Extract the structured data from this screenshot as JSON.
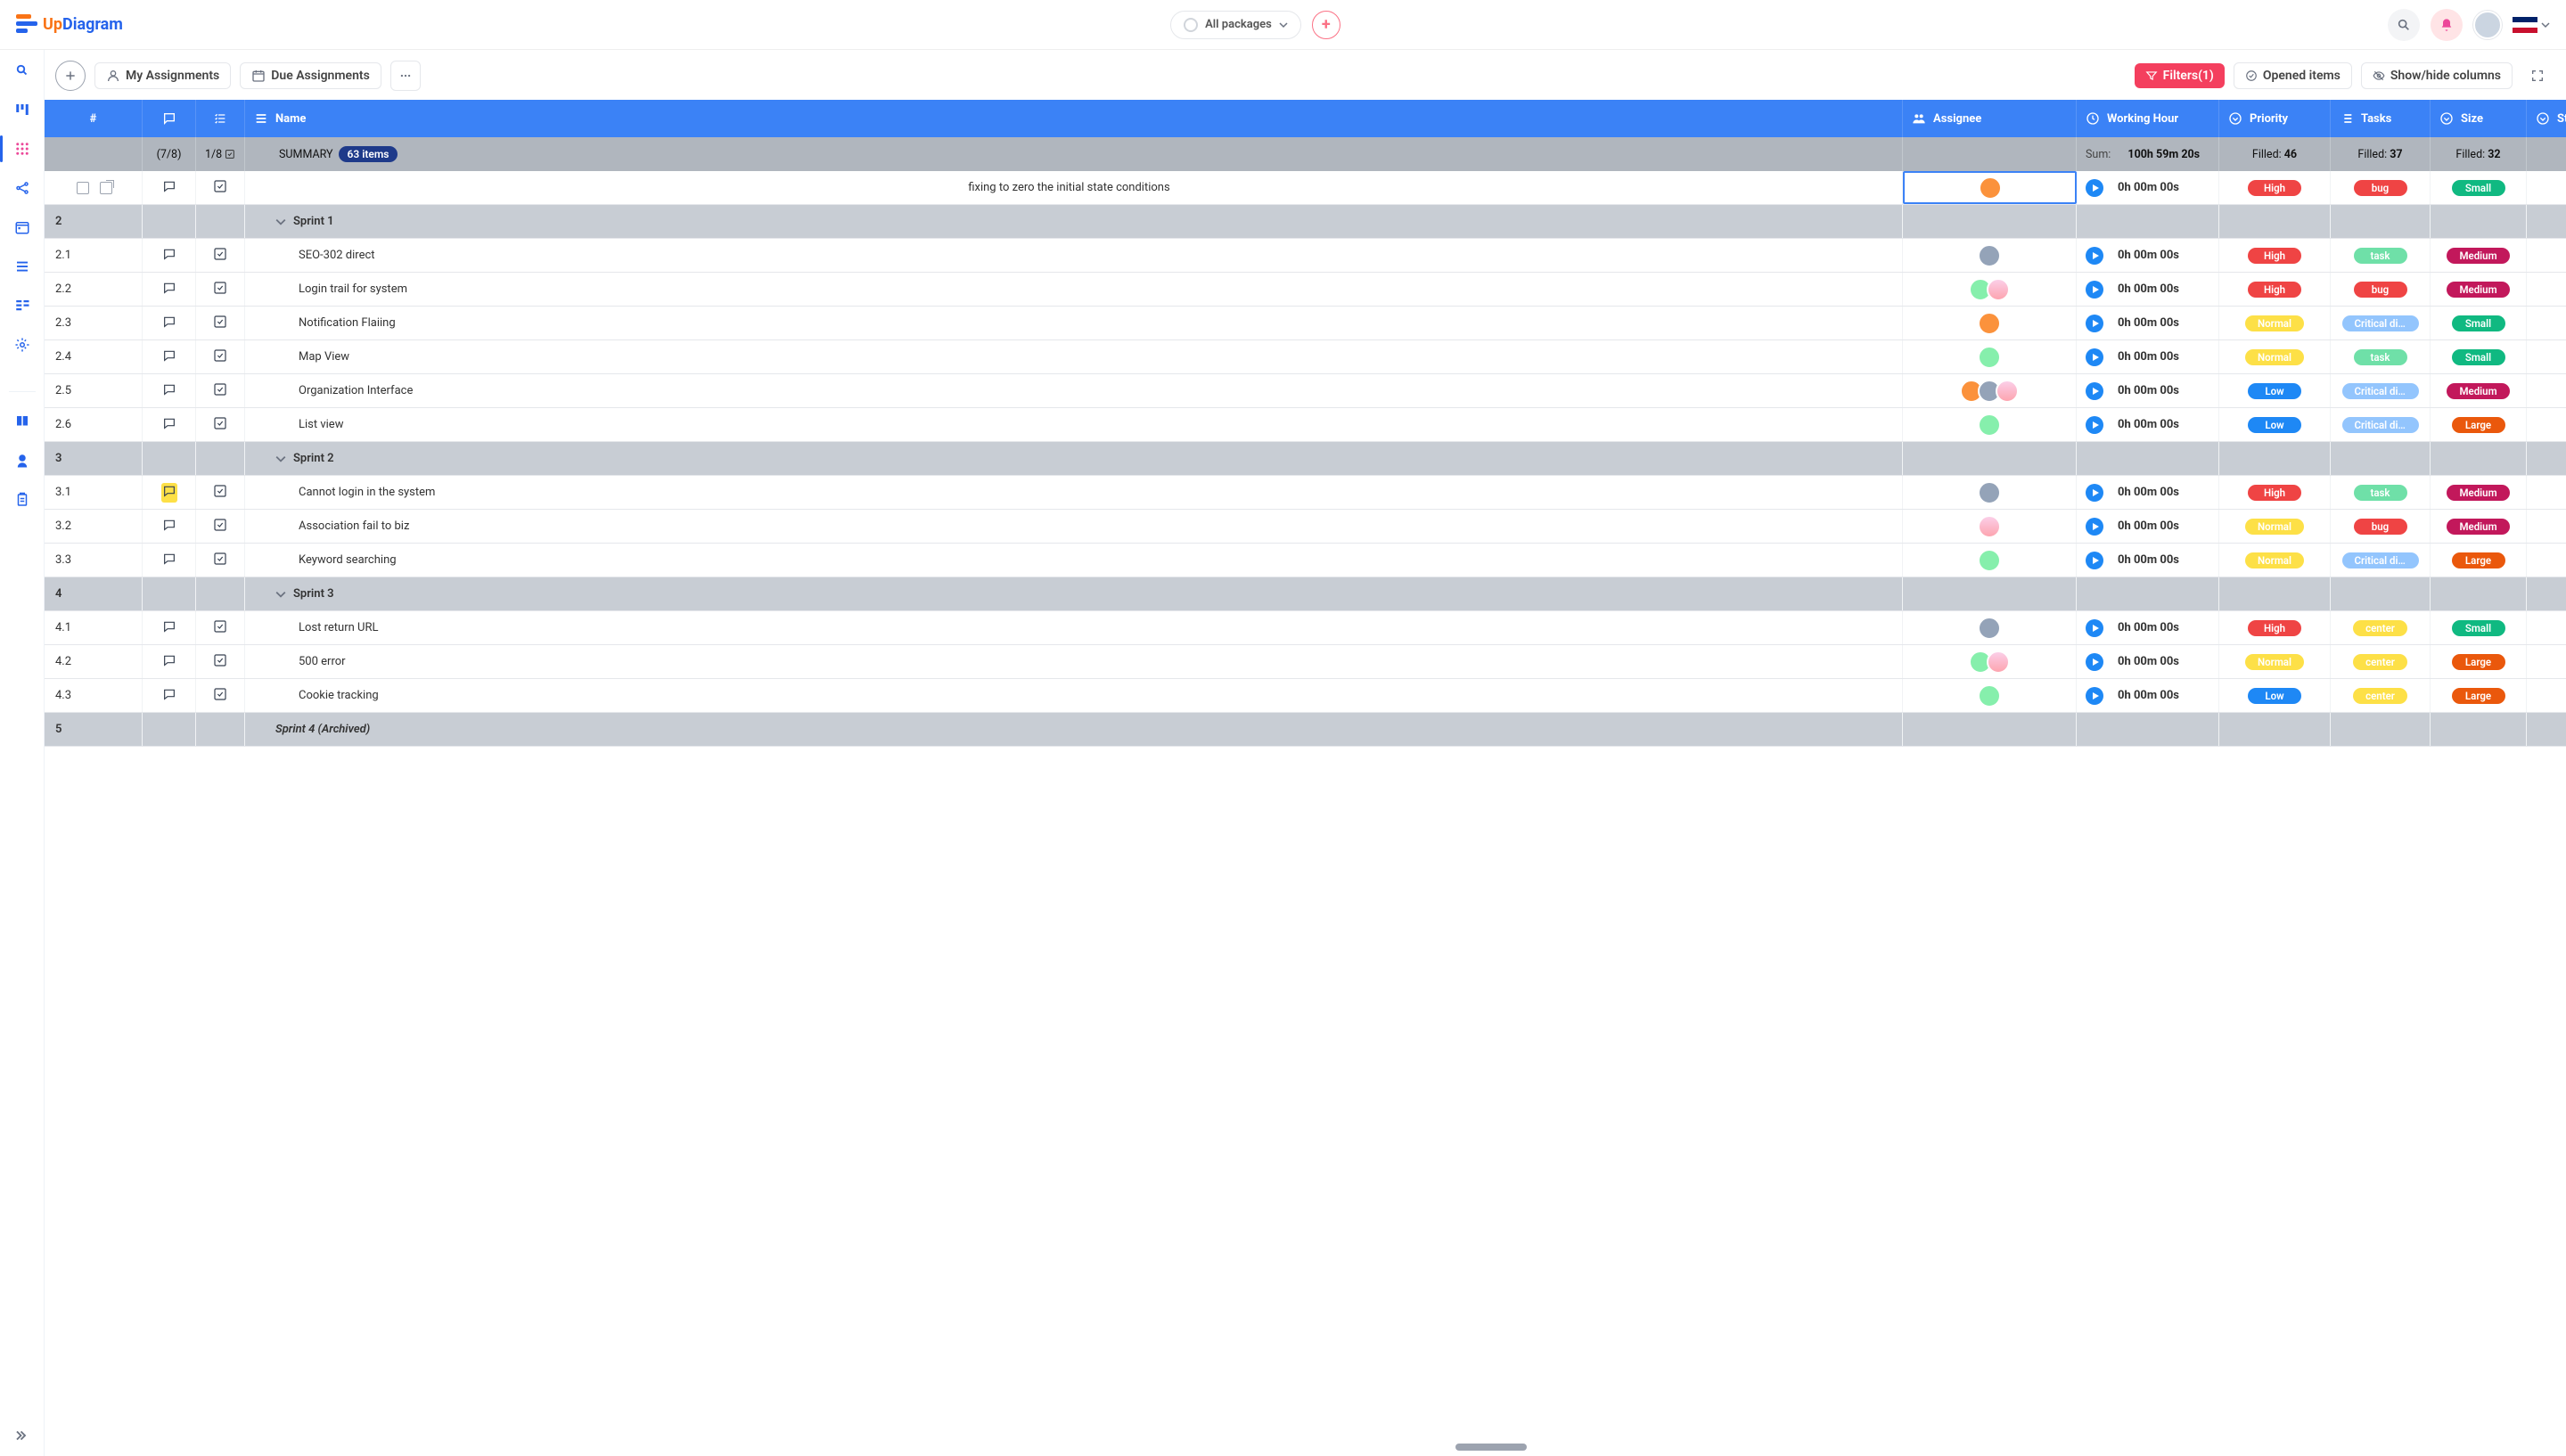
{
  "header": {
    "logo_a": "Up",
    "logo_b": "Diagram",
    "packages_label": "All packages"
  },
  "toolbar": {
    "my_assignments": "My Assignments",
    "due_assignments": "Due Assignments",
    "filters": "Filters(1)",
    "opened_items": "Opened items",
    "show_hide": "Show/hide columns"
  },
  "columns": {
    "idx": "#",
    "name": "Name",
    "assignee": "Assignee",
    "hours": "Working Hour",
    "priority": "Priority",
    "tasks": "Tasks",
    "size": "Size",
    "trailing": "St"
  },
  "summary": {
    "comment": "(7/8)",
    "check": "1/8",
    "label": "SUMMARY",
    "badge": "63 items",
    "hours_prefix": "Sum:",
    "hours": "100h 59m 20s",
    "priority": "Filled: 46",
    "tasks": "Filled: 37",
    "size": "Filled: 32"
  },
  "rows": [
    {
      "type": "item",
      "idx": "",
      "name": "fixing to zero the initial  state conditions",
      "assignees": [
        "a4"
      ],
      "hours": "0h 00m 00s",
      "priority": "High",
      "priorityClass": "high",
      "task": "bug",
      "taskClass": "bug",
      "size": "Small",
      "sizeClass": "small",
      "first": true,
      "checkbox": true
    },
    {
      "type": "group",
      "idx": "2",
      "name": "Sprint 1"
    },
    {
      "type": "item",
      "idx": "2.1",
      "name": "SEO-302 direct",
      "assignees": [
        "a0"
      ],
      "hours": "0h 00m 00s",
      "priority": "High",
      "priorityClass": "high",
      "task": "task",
      "taskClass": "task",
      "size": "Medium",
      "sizeClass": "medium"
    },
    {
      "type": "item",
      "idx": "2.2",
      "name": "Login trail for system",
      "assignees": [
        "a2",
        "a5"
      ],
      "hours": "0h 00m 00s",
      "priority": "High",
      "priorityClass": "high",
      "task": "bug",
      "taskClass": "bug",
      "size": "Medium",
      "sizeClass": "medium"
    },
    {
      "type": "item",
      "idx": "2.3",
      "name": "Notification Flaiing",
      "assignees": [
        "a4"
      ],
      "hours": "0h 00m 00s",
      "priority": "Normal",
      "priorityClass": "normal",
      "task": "Critical digita...",
      "taskClass": "critical",
      "size": "Small",
      "sizeClass": "small"
    },
    {
      "type": "item",
      "idx": "2.4",
      "name": "Map View",
      "assignees": [
        "a2"
      ],
      "hours": "0h 00m 00s",
      "priority": "Normal",
      "priorityClass": "normal",
      "task": "task",
      "taskClass": "task",
      "size": "Small",
      "sizeClass": "small"
    },
    {
      "type": "item",
      "idx": "2.5",
      "name": "Organization Interface",
      "assignees": [
        "a4",
        "a0",
        "a5"
      ],
      "hours": "0h 00m 00s",
      "priority": "Low",
      "priorityClass": "low",
      "task": "Critical digita...",
      "taskClass": "critical",
      "size": "Medium",
      "sizeClass": "medium"
    },
    {
      "type": "item",
      "idx": "2.6",
      "name": "List view",
      "assignees": [
        "a2"
      ],
      "hours": "0h 00m 00s",
      "priority": "Low",
      "priorityClass": "low",
      "task": "Critical digita...",
      "taskClass": "critical",
      "size": "Large",
      "sizeClass": "large"
    },
    {
      "type": "group",
      "idx": "3",
      "name": "Sprint 2"
    },
    {
      "type": "item",
      "idx": "3.1",
      "name": "Cannot login in the system",
      "assignees": [
        "a0"
      ],
      "hours": "0h 00m 00s",
      "priority": "High",
      "priorityClass": "high",
      "task": "task",
      "taskClass": "task",
      "size": "Medium",
      "sizeClass": "medium",
      "highlightComment": true
    },
    {
      "type": "item",
      "idx": "3.2",
      "name": "Association fail to biz",
      "assignees": [
        "a5"
      ],
      "hours": "0h 00m 00s",
      "priority": "Normal",
      "priorityClass": "normal",
      "task": "bug",
      "taskClass": "bug",
      "size": "Medium",
      "sizeClass": "medium"
    },
    {
      "type": "item",
      "idx": "3.3",
      "name": "Keyword searching",
      "assignees": [
        "a2"
      ],
      "hours": "0h 00m 00s",
      "priority": "Normal",
      "priorityClass": "normal",
      "task": "Critical digita...",
      "taskClass": "critical",
      "size": "Large",
      "sizeClass": "large"
    },
    {
      "type": "group",
      "idx": "4",
      "name": "Sprint 3"
    },
    {
      "type": "item",
      "idx": "4.1",
      "name": "Lost return URL",
      "assignees": [
        "a0"
      ],
      "hours": "0h 00m 00s",
      "priority": "High",
      "priorityClass": "high",
      "task": "center",
      "taskClass": "center",
      "size": "Small",
      "sizeClass": "small"
    },
    {
      "type": "item",
      "idx": "4.2",
      "name": "500 error",
      "assignees": [
        "a2",
        "a5"
      ],
      "hours": "0h 00m 00s",
      "priority": "Normal",
      "priorityClass": "normal",
      "task": "center",
      "taskClass": "center",
      "size": "Large",
      "sizeClass": "large"
    },
    {
      "type": "item",
      "idx": "4.3",
      "name": "Cookie tracking",
      "assignees": [
        "a2"
      ],
      "hours": "0h 00m 00s",
      "priority": "Low",
      "priorityClass": "low",
      "task": "center",
      "taskClass": "center",
      "size": "Large",
      "sizeClass": "large"
    },
    {
      "type": "group",
      "idx": "5",
      "name": "Sprint 4 (Archived)",
      "archived": true
    }
  ]
}
